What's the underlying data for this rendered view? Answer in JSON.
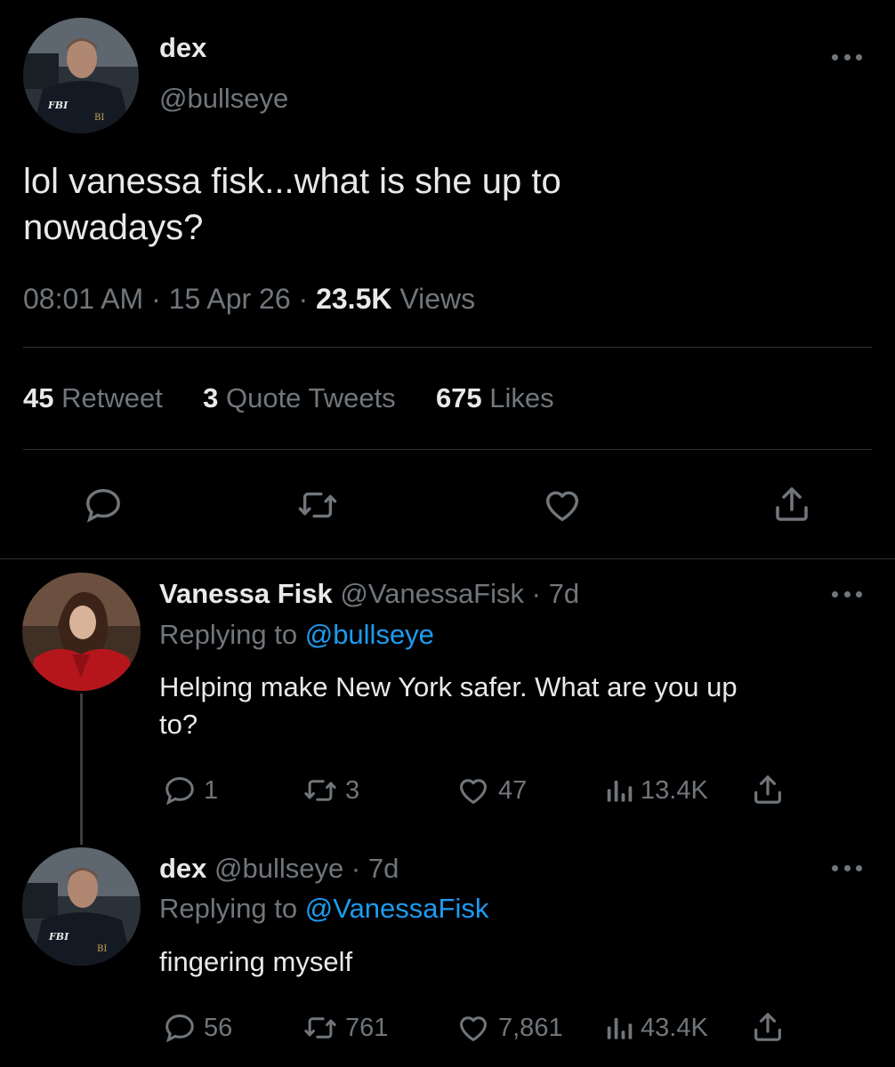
{
  "main_tweet": {
    "name": "dex",
    "handle": "@bullseye",
    "text_line1": "lol vanessa fisk...what is she up to",
    "text_line2": "nowadays?",
    "time": "08:01 AM",
    "date": "15 Apr 26",
    "views_count": "23.5K",
    "views_label": "Views",
    "stats": {
      "retweet_count": "45",
      "retweet_label": "Retweet",
      "quote_count": "3",
      "quote_label": "Quote Tweets",
      "likes_count": "675",
      "likes_label": "Likes"
    }
  },
  "reply1": {
    "name": "Vanessa Fisk",
    "handle": "@VanessaFisk",
    "age": "7d",
    "replying_prefix": "Replying to",
    "replying_to": "@bullseye",
    "text_line1": "Helping make New York safer. What are you up",
    "text_line2": "to?",
    "replies": "1",
    "retweets": "3",
    "likes": "47",
    "views": "13.4K"
  },
  "reply2": {
    "name": "dex",
    "handle": "@bullseye",
    "age": "7d",
    "replying_prefix": "Replying to",
    "replying_to": "@VanessaFisk",
    "text": "fingering myself",
    "replies": "56",
    "retweets": "761",
    "likes": "7,861",
    "views": "43.4K"
  },
  "icons": {
    "reply": "speech-bubble-icon",
    "retweet": "retweet-arrows-icon",
    "like": "heart-icon",
    "views": "bar-chart-icon",
    "share": "share-upload-icon",
    "more": "more-dots-icon"
  },
  "colors": {
    "background": "#000000",
    "text": "#e7e9ea",
    "secondary": "#71767b",
    "link": "#1d9bf0",
    "divider": "#2f3336"
  }
}
